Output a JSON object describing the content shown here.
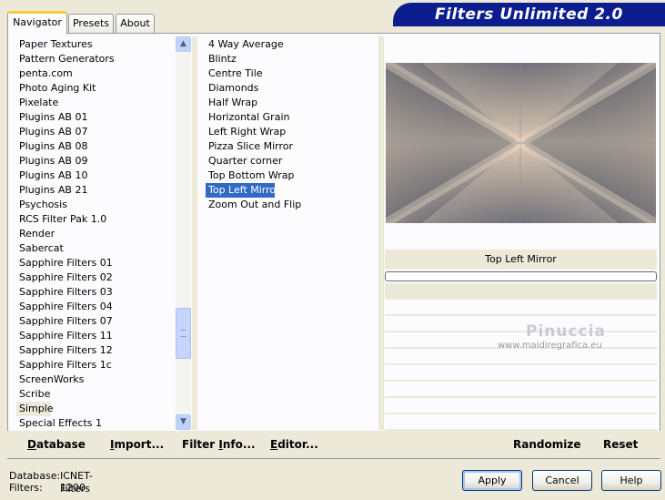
{
  "tabs": [
    {
      "label": "Navigator"
    },
    {
      "label": "Presets"
    },
    {
      "label": "About"
    }
  ],
  "header": {
    "title": "Filters Unlimited 2.0"
  },
  "categories": {
    "items": [
      "Paper Textures",
      "Pattern Generators",
      "penta.com",
      "Photo Aging Kit",
      "Pixelate",
      "Plugins AB 01",
      "Plugins AB 07",
      "Plugins AB 08",
      "Plugins AB 09",
      "Plugins AB 10",
      "Plugins AB 21",
      "Psychosis",
      "RCS Filter Pak 1.0",
      "Render",
      "Sabercat",
      "Sapphire Filters 01",
      "Sapphire Filters 02",
      "Sapphire Filters 03",
      "Sapphire Filters 04",
      "Sapphire Filters 07",
      "Sapphire Filters 11",
      "Sapphire Filters 12",
      "Sapphire Filters 1c",
      "ScreenWorks",
      "Scribe",
      "Simple",
      "Special Effects 1"
    ],
    "selected": "Simple"
  },
  "filters": {
    "items": [
      "4 Way Average",
      "Blintz",
      "Centre Tile",
      "Diamonds",
      "Half Wrap",
      "Horizontal Grain",
      "Left Right Wrap",
      "Pizza Slice Mirror",
      "Quarter corner",
      "Top Bottom Wrap",
      "Top Left Mirror",
      "Zoom Out and Flip"
    ],
    "selected": "Top Left Mirror"
  },
  "preview": {
    "label": "Top Left Mirror"
  },
  "watermark": {
    "title": "Pinuccia",
    "url": "www.maidiregrafica.eu"
  },
  "toolbar": {
    "database": {
      "u": "D",
      "rest": "atabase"
    },
    "import": {
      "u": "I",
      "rest": "mport..."
    },
    "filter_info": {
      "pre": "Filter ",
      "u": "I",
      "rest": "nfo..."
    },
    "editor": {
      "u": "E",
      "rest": "ditor..."
    },
    "randomize": "Randomize",
    "reset": "Reset"
  },
  "info": {
    "database_label": "Database:",
    "database_value": "ICNET-Filters",
    "filters_label": "Filters:",
    "filters_value": "1200"
  },
  "buttons": {
    "apply": "Apply",
    "cancel": "Cancel",
    "help": "Help"
  },
  "colors": {
    "selection": "#316AC5",
    "banner": "#0C1E8E"
  }
}
